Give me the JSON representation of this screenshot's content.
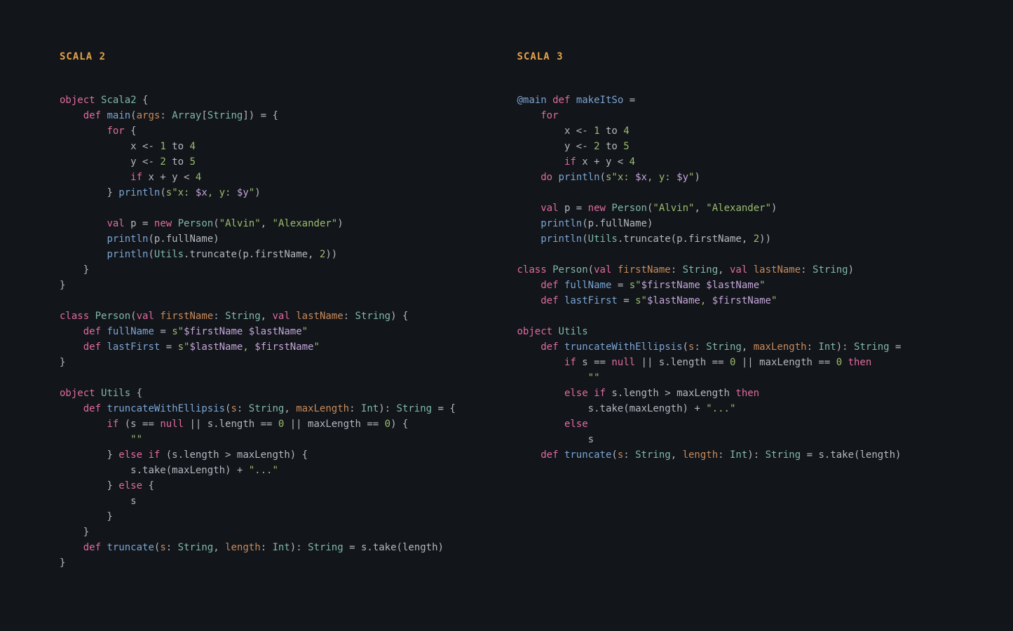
{
  "left": {
    "heading": "SCALA 2",
    "code": {
      "l1_obj": "object",
      "l1_name": "Scala2",
      "l1_brace": " {",
      "l2_def": "def",
      "l2_main": "main",
      "l2_args": "args",
      "l2_array": "Array",
      "l2_string": "String",
      "l3_for": "for",
      "l3_brace": " {",
      "l4_x": "x <- ",
      "l4_1": "1",
      "l4_to": " to ",
      "l4_4": "4",
      "l5_y": "y <- ",
      "l5_2": "2",
      "l5_to": " to ",
      "l5_5": "5",
      "l6_if": "if",
      "l6_cond": " x + y < ",
      "l6_4": "4",
      "l7_close": "} ",
      "l7_println": "println",
      "l7_s": "s",
      "l7_pre": "\"x: ",
      "l7_ix": "$x",
      "l7_mid": ", y: ",
      "l7_iy": "$y",
      "l7_post": "\"",
      "l9_val": "val",
      "l9_p": " p = ",
      "l9_new": "new",
      "l9_person": "Person",
      "l9_a1": "\"Alvin\"",
      "l9_a2": "\"Alexander\"",
      "l10_println": "println",
      "l10_arg": "(p.fullName)",
      "l11_println": "println",
      "l11_utils": "Utils",
      "l11_rest": ".truncate(p.firstName, ",
      "l11_2": "2",
      "l11_close": "))",
      "l12_b": "    }",
      "l13_b": "}",
      "l15_class": "class",
      "l15_person": "Person",
      "l15_val1": "val",
      "l15_fn": "firstName",
      "l15_string1": "String",
      "l15_val2": "val",
      "l15_ln": "lastName",
      "l15_string2": "String",
      "l15_brace": ") {",
      "l16_def": "def",
      "l16_fullname": "fullName",
      "l16_eq": " = ",
      "l16_s": "s",
      "l16_q1": "\"",
      "l16_i1": "$firstName ",
      "l16_i2": "$lastName",
      "l16_q2": "\"",
      "l17_def": "def",
      "l17_lf": "lastFirst",
      "l17_eq": " = ",
      "l17_s": "s",
      "l17_q1": "\"",
      "l17_i1": "$lastName",
      "l17_mid": ", ",
      "l17_i2": "$firstName",
      "l17_q2": "\"",
      "l18_b": "}",
      "l20_obj": "object",
      "l20_utils": "Utils",
      "l20_brace": " {",
      "l21_def": "def",
      "l21_twe": "truncateWithEllipsis",
      "l21_s": "s",
      "l21_string1": "String",
      "l21_ml": "maxLength",
      "l21_int": "Int",
      "l21_string2": "String",
      "l21_eq": " = {",
      "l22_if": "if",
      "l22_open": " (s == ",
      "l22_null": "null",
      "l22_or1": " || s.length == ",
      "l22_0a": "0",
      "l22_or2": " || maxLength == ",
      "l22_0b": "0",
      "l22_close": ") {",
      "l23_empty": "\"\"",
      "l24_close": "} ",
      "l24_else": "else",
      "l24_if": "if",
      "l24_cond": " (s.length > maxLength) {",
      "l25_take": "s.take(maxLength) + ",
      "l25_dots": "\"...\"",
      "l26_close": "} ",
      "l26_else": "else",
      "l26_brace": " {",
      "l27_s": "s",
      "l28_b": "        }",
      "l29_b": "    }",
      "l30_def": "def",
      "l30_trunc": "truncate",
      "l30_s": "s",
      "l30_string1": "String",
      "l30_len": "length",
      "l30_int": "Int",
      "l30_string2": "String",
      "l30_eq": " = s.take(length)",
      "l31_b": "}"
    }
  },
  "right": {
    "heading": "SCALA 3",
    "code": {
      "r1_at": "@main",
      "r1_def": "def",
      "r1_name": "makeItSo",
      "r1_eq": " =",
      "r2_for": "for",
      "r3_x": "x <- ",
      "r3_1": "1",
      "r3_to": " to ",
      "r3_4": "4",
      "r4_y": "y <- ",
      "r4_2": "2",
      "r4_to": " to ",
      "r4_5": "5",
      "r5_if": "if",
      "r5_cond": " x + y < ",
      "r5_4": "4",
      "r6_do": "do",
      "r6_println": "println",
      "r6_s": "s",
      "r6_pre": "\"x: ",
      "r6_ix": "$x",
      "r6_mid": ", y: ",
      "r6_iy": "$y",
      "r6_post": "\"",
      "r8_val": "val",
      "r8_p": " p = ",
      "r8_new": "new",
      "r8_person": "Person",
      "r8_a1": "\"Alvin\"",
      "r8_a2": "\"Alexander\"",
      "r9_println": "println",
      "r9_arg": "(p.fullName)",
      "r10_println": "println",
      "r10_utils": "Utils",
      "r10_rest": ".truncate(p.firstName, ",
      "r10_2": "2",
      "r10_close": "))",
      "r12_class": "class",
      "r12_person": "Person",
      "r12_val1": "val",
      "r12_fn": "firstName",
      "r12_string1": "String",
      "r12_val2": "val",
      "r12_ln": "lastName",
      "r12_string2": "String",
      "r13_def": "def",
      "r13_fullname": "fullName",
      "r13_eq": " = ",
      "r13_s": "s",
      "r13_q1": "\"",
      "r13_i1": "$firstName ",
      "r13_i2": "$lastName",
      "r13_q2": "\"",
      "r14_def": "def",
      "r14_lf": "lastFirst",
      "r14_eq": " = ",
      "r14_s": "s",
      "r14_q1": "\"",
      "r14_i1": "$lastName",
      "r14_mid": ", ",
      "r14_i2": "$firstName",
      "r14_q2": "\"",
      "r16_obj": "object",
      "r16_utils": "Utils",
      "r17_def": "def",
      "r17_twe": "truncateWithEllipsis",
      "r17_s": "s",
      "r17_string1": "String",
      "r17_ml": "maxLength",
      "r17_int": "Int",
      "r17_string2": "String",
      "r17_eq": " =",
      "r18_if": "if",
      "r18_open": " s == ",
      "r18_null": "null",
      "r18_or1": " || s.length == ",
      "r18_0a": "0",
      "r18_or2": " || maxLength == ",
      "r18_0b": "0",
      "r18_then": "then",
      "r19_empty": "\"\"",
      "r20_else": "else",
      "r20_if": "if",
      "r20_cond": " s.length > maxLength ",
      "r20_then": "then",
      "r21_take": "s.take(maxLength) + ",
      "r21_dots": "\"...\"",
      "r22_else": "else",
      "r23_s": "s",
      "r24_def": "def",
      "r24_trunc": "truncate",
      "r24_s": "s",
      "r24_string1": "String",
      "r24_len": "length",
      "r24_int": "Int",
      "r24_string2": "String",
      "r24_eq": " = s.take(length)"
    }
  }
}
